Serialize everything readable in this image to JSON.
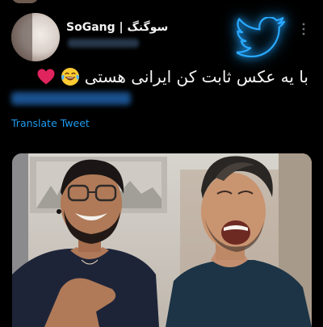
{
  "tweet": {
    "author_name": "SoGang | سوگنگ",
    "text": "با یه عکس ثابت کن ایرانی هستی",
    "translate_label": "Translate Tweet"
  },
  "icons": {
    "brand": "twitter-bird-icon",
    "menu": "more-vertical-icon",
    "emoji_1": "face-with-tears-of-joy-emoji",
    "emoji_2": "red-heart-emoji"
  },
  "colors": {
    "background": "#000000",
    "link_blue": "#1d9bf0",
    "text": "#f5f5f5",
    "heart": "#e0245e"
  }
}
